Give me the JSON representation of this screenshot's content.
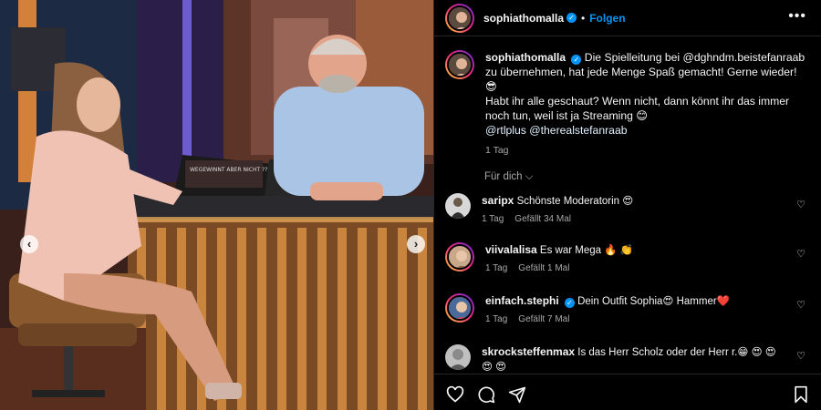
{
  "post": {
    "username": "sophiathomalla",
    "follow_label": "Folgen",
    "more_label": "•••",
    "caption": {
      "line1": "Die Spielleitung bei @dghndm.beistefanraab zu übernehmen, hat jede Menge Spaß gemacht! Gerne wieder!",
      "emoji1": "😎",
      "line2": "Habt ihr alle geschaut? Wenn nicht, dann könnt ihr das immer noch tun, weil ist ja Streaming 😊",
      "line3": "@rtlplus @therealstefanraab",
      "time": "1 Tag"
    },
    "for_you_label": "Für dich"
  },
  "comments": [
    {
      "username": "saripx",
      "text": "Schönste Moderatorin 😍",
      "time": "1 Tag",
      "likes": "Gefällt 34 Mal",
      "verified": false
    },
    {
      "username": "viivalalisa",
      "text": "Es war Mega 🔥 👏",
      "time": "1 Tag",
      "likes": "Gefällt 1 Mal",
      "verified": false
    },
    {
      "username": "einfach.stephi",
      "text": "Dein Outfit Sophia😍 Hammer❤️",
      "time": "1 Tag",
      "likes": "Gefällt 7 Mal",
      "verified": true
    },
    {
      "username": "skrocksteffenmax",
      "text": "Is das Herr Scholz oder der Herr r.😁 😍 😍 😍 😍",
      "time": "",
      "likes": "",
      "verified": false
    }
  ],
  "photo": {
    "desk_sign": "WEGEWINNT ABER NICHT ???. MILLION !!!"
  },
  "icons": {
    "prev": "chevron-left-icon",
    "next": "chevron-right-icon",
    "like": "heart-icon",
    "comment": "comment-icon",
    "share": "send-icon",
    "save": "bookmark-icon"
  },
  "colors": {
    "accent": "#0095f6",
    "background": "#000000",
    "muted": "#a8a8a8"
  }
}
